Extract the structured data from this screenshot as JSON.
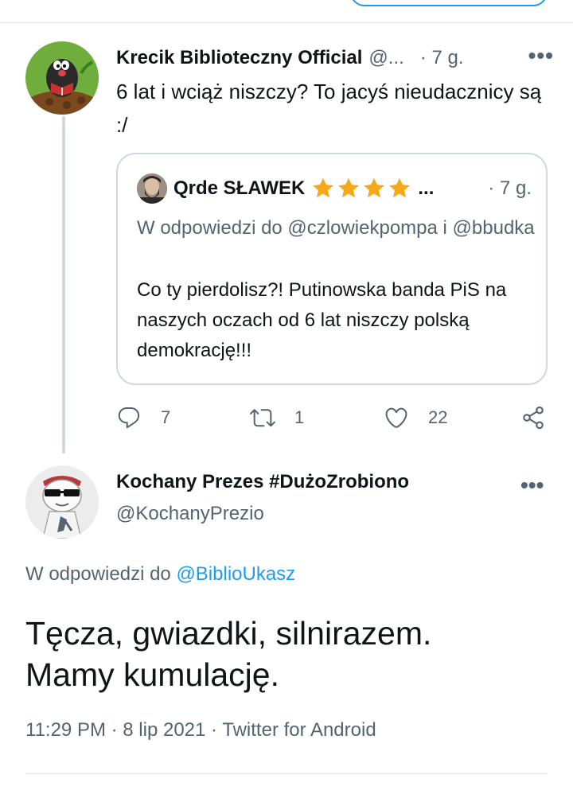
{
  "colors": {
    "accent": "#1d9bf0",
    "secondary_text": "#536471",
    "star": "#f4a81c"
  },
  "parent_tweet": {
    "avatar_icon": "mole-reading-book-avatar",
    "display_name": "Krecik Biblioteczny Official",
    "handle": "@...",
    "time": "· 7 g.",
    "more": "•••",
    "text": "6 lat i wciąż niszczy? To jacyś nieudacznicy są :/",
    "quoted": {
      "avatar_icon": "man-photo-avatar",
      "display_name": "Qrde SŁAWEK",
      "stars": 4,
      "ellipsis": "...",
      "time": "· 7 g.",
      "reply_line": "W odpowiedzi do @czlowiekpompa i @bbudka",
      "text": "Co ty pierdolisz?! Putinowska banda PiS na naszych oczach od 6 lat niszczy polską demokrację!!!"
    },
    "actions": {
      "replies": "7",
      "retweets": "1",
      "likes": "22"
    }
  },
  "main_tweet": {
    "avatar_icon": "cartoon-character-sunglasses-avatar",
    "display_name": "Kochany Prezes #DużoZrobiono",
    "handle": "@KochanyPrezio",
    "more": "•••",
    "reply_prefix": "W odpowiedzi do ",
    "reply_handle": "@BiblioUkasz",
    "text_line1": "Tęcza, gwiazdki, silnirazem.",
    "text_line2": "Mamy kumulację.",
    "timestamp": "11:29 PM · 8 lip 2021 · Twitter for Android"
  }
}
